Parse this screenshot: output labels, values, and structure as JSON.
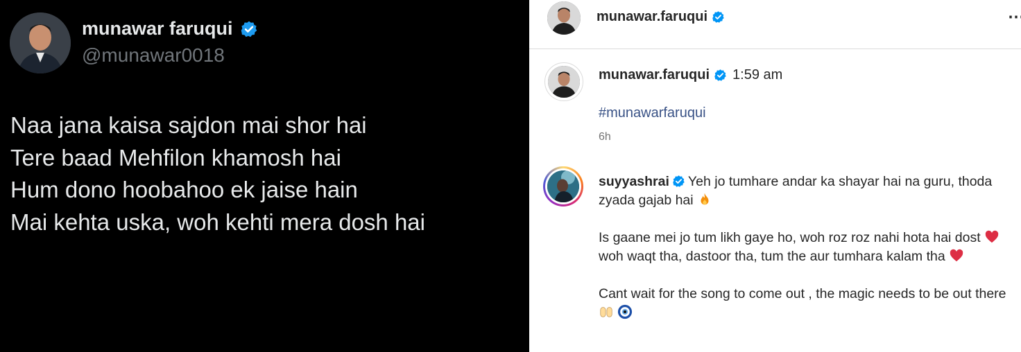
{
  "tweet": {
    "display_name": "munawar faruqui",
    "handle": "@munawar0018",
    "lines": [
      "Naa jana kaisa sajdon mai shor hai",
      "Tere baad Mehfilon khamosh hai",
      "Hum dono hoobahoo ek jaise hain",
      "Mai kehta uska, woh kehti mera dosh hai"
    ]
  },
  "instagram": {
    "header_username": "munawar.faruqui",
    "more_glyph": "⋯",
    "post": {
      "username": "munawar.faruqui",
      "time": "1:59 am",
      "caption": "#munawarfaruqui",
      "age": "6h"
    },
    "comment": {
      "username": "suyyashrai",
      "line1": "Yeh jo tumhare andar ka shayar hai na guru, thoda zyada gajab hai",
      "para2_a": "Is gaane mei jo tum likh gaye ho, woh roz roz nahi hota hai dost",
      "para2_b": "woh waqt tha, dastoor tha, tum the aur tumhara kalam tha",
      "para3": "Cant wait for the song to come out , the magic needs to be out there"
    }
  },
  "colors": {
    "twitter_bg": "#000000",
    "twitter_handle": "#71767b",
    "verified_blue": "#1d9bf0",
    "ig_link": "#385185",
    "ig_meta": "#737373"
  }
}
